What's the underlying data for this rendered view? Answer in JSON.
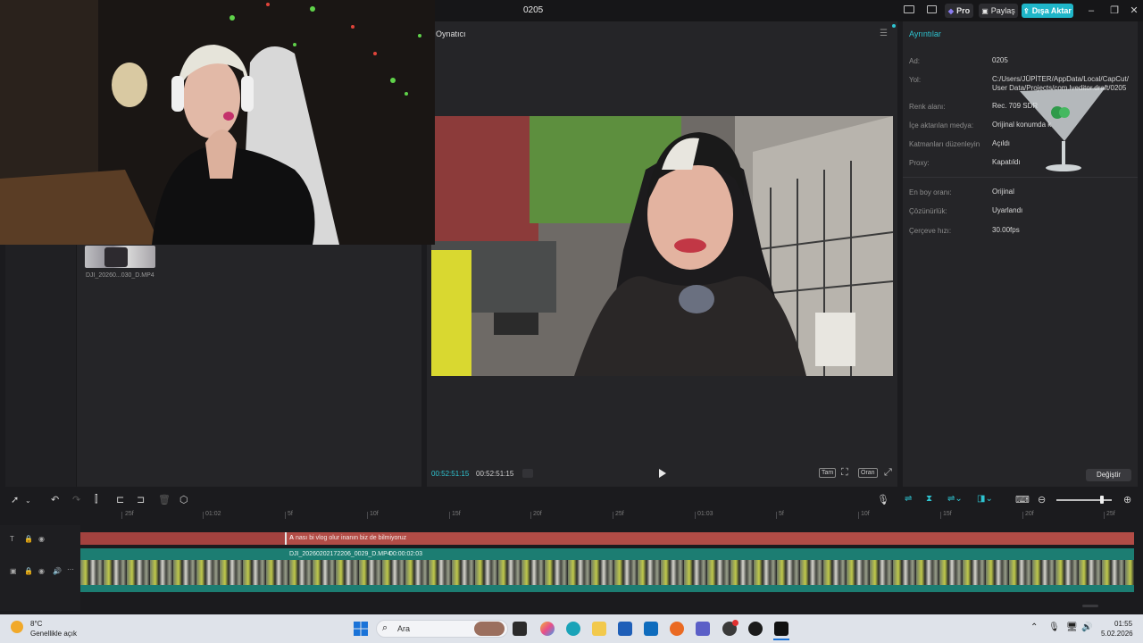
{
  "app": {
    "title": "0205"
  },
  "toolbar": {
    "pro_label": "Pro",
    "share_label": "Paylaş",
    "export_label": "Dışa Aktar"
  },
  "media": {
    "clip_name": "DJI_20260...030_D.MP4"
  },
  "player": {
    "title": "Oynatıcı",
    "time_current": "00:52:51:15",
    "time_total": "00:52:51:15",
    "ctl_full": "Tam",
    "ctl_ratio": "Oran"
  },
  "details": {
    "tab": "Ayrıntılar",
    "rows": [
      {
        "label": "Ad:",
        "value": "0205"
      },
      {
        "label": "Yol:",
        "value": "C:/Users/JÜPİTER/AppData/Local/CapCut/User Data/Projects/com.lveditor.draft/0205"
      },
      {
        "label": "Renk alanı:",
        "value": "Rec. 709 SDR"
      },
      {
        "label": "İçe aktarılan medya:",
        "value": "Orijinal konumda k"
      },
      {
        "label": "Katmanları düzenleyin",
        "value": "Açıldı"
      },
      {
        "label": "Proxy:",
        "value": "Kapatıldı"
      },
      {
        "label": "En boy oranı:",
        "value": "Orijinal"
      },
      {
        "label": "Çözünürlük:",
        "value": "Uyarlandı"
      },
      {
        "label": "Çerçeve hızı:",
        "value": "30.00fps"
      }
    ],
    "change_label": "Değiştir"
  },
  "timeline": {
    "ticks": [
      "25f",
      "01:02",
      "5f",
      "10f",
      "15f",
      "20f",
      "25f",
      "01:03",
      "5f",
      "10f",
      "15f",
      "20f",
      "25f"
    ],
    "text_clip": "nası bi vlog olur inanın biz de bilmiyoruz",
    "video_clip": "DJI_20260202172206_0029_D.MP4",
    "video_duration": "00:00:02:03"
  },
  "taskbar": {
    "weather_temp": "8°C",
    "weather_desc": "Genellikle açık",
    "search_placeholder": "Ara",
    "time": "01:55",
    "date": "5.02.2026"
  },
  "colors": {
    "accent": "#2ec4d1",
    "text_clip": "#a3423f",
    "video_clip": "#1c7d72"
  }
}
